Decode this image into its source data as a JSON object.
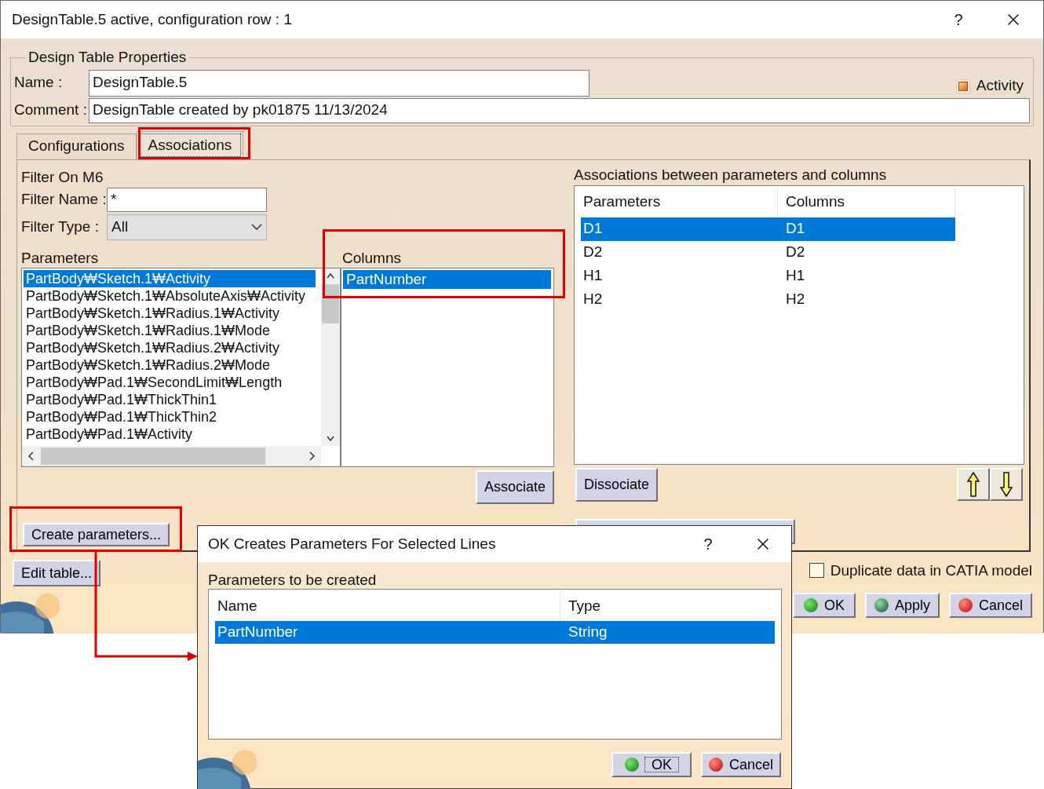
{
  "window": {
    "title": "DesignTable.5 active, configuration row : 1",
    "help": "?"
  },
  "properties": {
    "legend": "Design Table Properties",
    "name_label": "Name :",
    "name_value": "DesignTable.5",
    "comment_label": "Comment :",
    "comment_value": "DesignTable created by pk01875 11/13/2024",
    "activity": {
      "label": "Activity",
      "checked": true
    }
  },
  "tabs": [
    {
      "label": "Configurations",
      "selected": false
    },
    {
      "label": "Associations",
      "selected": true
    }
  ],
  "filter": {
    "title": "Filter On M6",
    "name_label": "Filter Name :",
    "name_value": "*",
    "type_label": "Filter Type :",
    "type_value": "All"
  },
  "parameters": {
    "label": "Parameters",
    "items": [
      {
        "text": "PartBody₩Sketch.1₩Activity",
        "selected": true
      },
      {
        "text": "PartBody₩Sketch.1₩AbsoluteAxis₩Activity",
        "selected": false
      },
      {
        "text": "PartBody₩Sketch.1₩Radius.1₩Activity",
        "selected": false
      },
      {
        "text": "PartBody₩Sketch.1₩Radius.1₩Mode",
        "selected": false
      },
      {
        "text": "PartBody₩Sketch.1₩Radius.2₩Activity",
        "selected": false
      },
      {
        "text": "PartBody₩Sketch.1₩Radius.2₩Mode",
        "selected": false
      },
      {
        "text": "PartBody₩Pad.1₩SecondLimit₩Length",
        "selected": false
      },
      {
        "text": "PartBody₩Pad.1₩ThickThin1",
        "selected": false
      },
      {
        "text": "PartBody₩Pad.1₩ThickThin2",
        "selected": false
      },
      {
        "text": "PartBody₩Pad.1₩Activity",
        "selected": false
      }
    ]
  },
  "columns": {
    "label": "Columns",
    "items": [
      {
        "text": "PartNumber",
        "selected": true
      }
    ]
  },
  "associate_button": "Associate",
  "associations": {
    "label": "Associations between parameters and columns",
    "headers": [
      "Parameters",
      "Columns"
    ],
    "rows": [
      {
        "parameter": "D1",
        "column": "D1",
        "selected": true
      },
      {
        "parameter": "D2",
        "column": "D2",
        "selected": false
      },
      {
        "parameter": "H1",
        "column": "H1",
        "selected": false
      },
      {
        "parameter": "H2",
        "column": "H2",
        "selected": false
      }
    ]
  },
  "dissociate_button": "Dissociate",
  "create_parameters_button": "Create parameters...",
  "edit_table_button": "Edit table...",
  "duplicate_data": {
    "label": "Duplicate data in CATIA model",
    "checked": false
  },
  "dialog_buttons": [
    {
      "label": "OK",
      "kind": "ok"
    },
    {
      "label": "Apply",
      "kind": "apply"
    },
    {
      "label": "Cancel",
      "kind": "cancel"
    }
  ],
  "popup": {
    "title": "OK Creates Parameters For Selected Lines",
    "help": "?",
    "section_label": "Parameters to be created",
    "headers": [
      "Name",
      "Type"
    ],
    "rows": [
      {
        "name": "PartNumber",
        "type": "String",
        "selected": true
      }
    ],
    "buttons": [
      {
        "label": "OK",
        "kind": "ok"
      },
      {
        "label": "Cancel",
        "kind": "cancel"
      }
    ]
  }
}
